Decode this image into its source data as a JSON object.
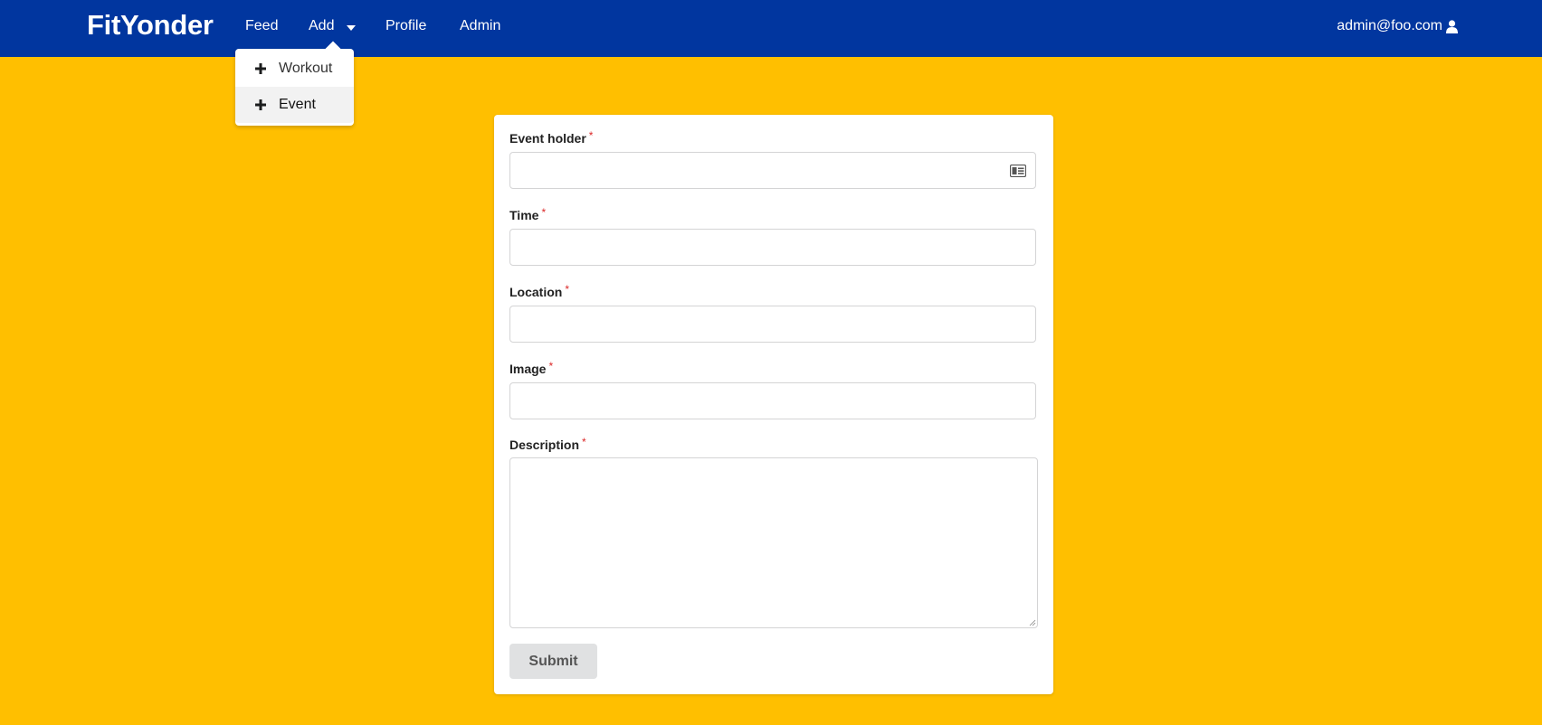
{
  "nav": {
    "brand": "FitYonder",
    "items": [
      {
        "label": "Feed"
      },
      {
        "label": "Add"
      },
      {
        "label": "Profile"
      },
      {
        "label": "Admin"
      }
    ],
    "user_email": "admin@foo.com",
    "user_icon": "user-icon",
    "colors": {
      "navbar": "#01369F",
      "page_background": "#FFBF00"
    }
  },
  "add_menu": {
    "items": [
      {
        "label": "Workout",
        "icon": "plus-icon"
      },
      {
        "label": "Event",
        "icon": "plus-icon"
      }
    ]
  },
  "form": {
    "fields": [
      {
        "label": "Event holder",
        "required_mark": "*",
        "value": "",
        "icon": "id-card-icon"
      },
      {
        "label": "Time",
        "required_mark": "*",
        "value": ""
      },
      {
        "label": "Location",
        "required_mark": "*",
        "value": ""
      },
      {
        "label": "Image",
        "required_mark": "*",
        "value": ""
      },
      {
        "label": "Description",
        "required_mark": "*",
        "value": ""
      }
    ],
    "submit_label": "Submit"
  }
}
